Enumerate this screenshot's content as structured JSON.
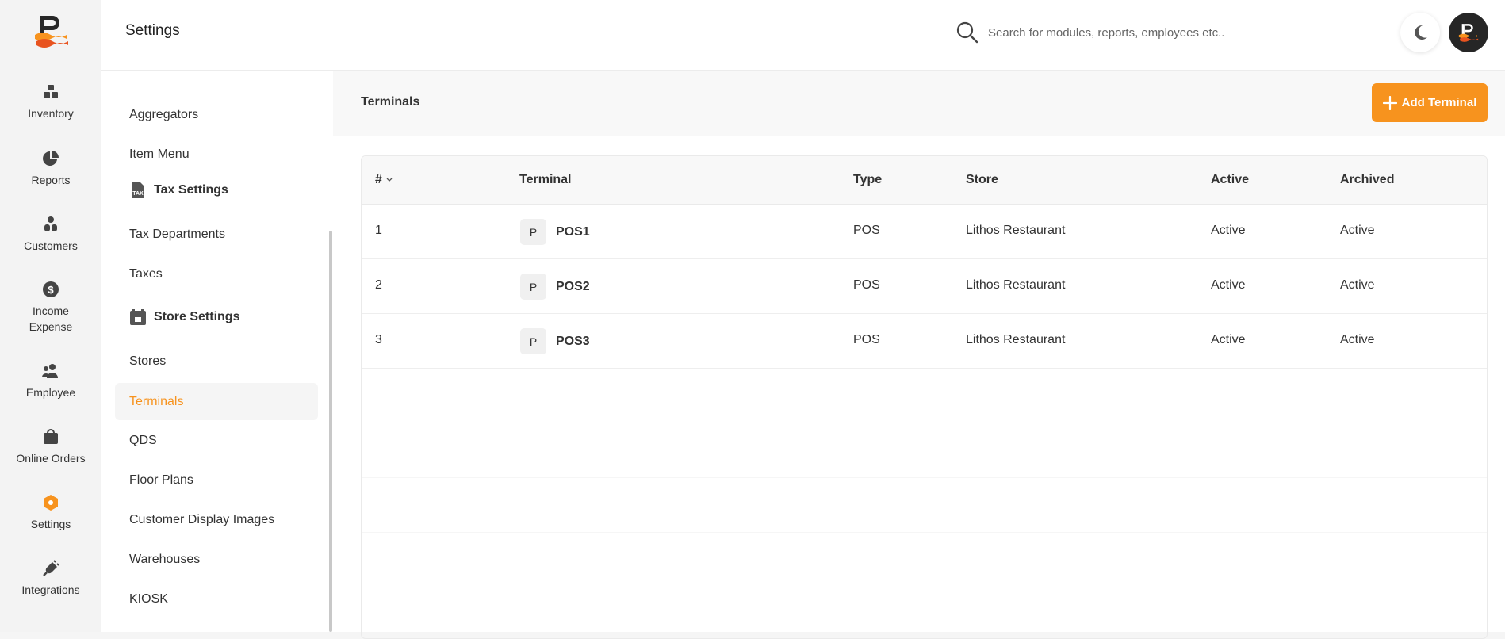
{
  "app": {
    "brand_color": "#f7931e"
  },
  "rail": [
    {
      "label": "Inventory",
      "icon": "boxes-icon"
    },
    {
      "label": "Reports",
      "icon": "pie-chart-icon"
    },
    {
      "label": "Customers",
      "icon": "customers-icon"
    },
    {
      "label": "Income Expense",
      "icon": "dollar-circle-icon"
    },
    {
      "label": "Employee",
      "icon": "employees-icon"
    },
    {
      "label": "Online Orders",
      "icon": "shopping-bag-icon"
    },
    {
      "label": "Settings",
      "icon": "settings-hexagon-icon",
      "active": true
    },
    {
      "label": "Integrations",
      "icon": "plug-icon"
    }
  ],
  "header": {
    "title": "Settings",
    "search_placeholder": "Search for modules, reports, employees etc.."
  },
  "submenu": {
    "items_top": [
      "Aggregators",
      "Item Menu"
    ],
    "tax_heading": "Tax Settings",
    "tax_items": [
      "Tax Departments",
      "Taxes"
    ],
    "store_heading": "Store Settings",
    "store_items": [
      "Stores",
      "Terminals",
      "QDS",
      "Floor Plans",
      "Customer Display Images",
      "Warehouses",
      "KIOSK"
    ],
    "active": "Terminals"
  },
  "main": {
    "title": "Terminals",
    "add_button": "Add Terminal"
  },
  "table": {
    "columns": [
      "#",
      "Terminal",
      "Type",
      "Store",
      "Active",
      "Archived"
    ],
    "rows": [
      {
        "num": "1",
        "badge": "P",
        "terminal": "POS1",
        "type": "POS",
        "store": "Lithos Restaurant",
        "active": "Active",
        "archived": "Active"
      },
      {
        "num": "2",
        "badge": "P",
        "terminal": "POS2",
        "type": "POS",
        "store": "Lithos Restaurant",
        "active": "Active",
        "archived": "Active"
      },
      {
        "num": "3",
        "badge": "P",
        "terminal": "POS3",
        "type": "POS",
        "store": "Lithos Restaurant",
        "active": "Active",
        "archived": "Active"
      }
    ]
  }
}
